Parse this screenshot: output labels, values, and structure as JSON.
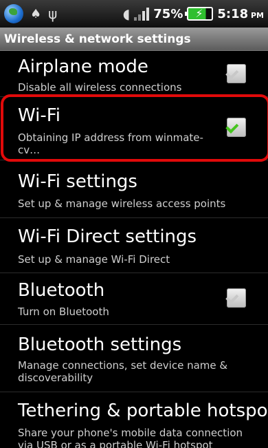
{
  "status_bar": {
    "battery": "75%",
    "time": "5:18",
    "ampm": "PM"
  },
  "title": "Wireless & network settings",
  "items": [
    {
      "title": "Airplane mode",
      "summary": "Disable all wireless connections",
      "checkbox": true,
      "checked": false
    },
    {
      "title": "Wi-Fi",
      "summary": "Obtaining IP address from winmate-cv…",
      "checkbox": true,
      "checked": true
    },
    {
      "title": "Wi-Fi settings",
      "summary": "Set up & manage wireless access points",
      "checkbox": false
    },
    {
      "title": "Wi-Fi Direct settings",
      "summary": "Set up & manage Wi-Fi Direct",
      "checkbox": false
    },
    {
      "title": "Bluetooth",
      "summary": "Turn on Bluetooth",
      "checkbox": true,
      "checked": false
    },
    {
      "title": "Bluetooth settings",
      "summary": "Manage connections, set device name & discoverability",
      "checkbox": false
    },
    {
      "title": "Tethering & portable hotspot",
      "summary": "Share your phone's mobile data connection via USB or as a portable Wi-Fi hotspot",
      "checkbox": false
    }
  ],
  "colors": {
    "highlight": "#e10a0a",
    "check_on": "#46c51f"
  }
}
